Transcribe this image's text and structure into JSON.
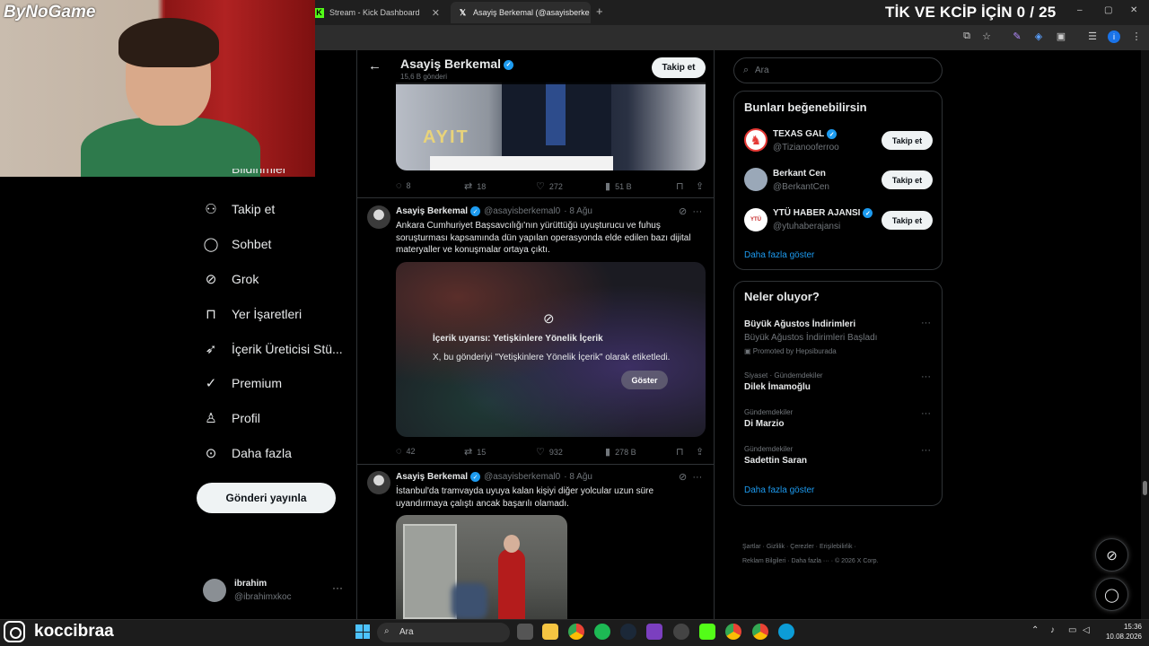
{
  "browser": {
    "tabs": [
      {
        "label": "Stream - Kick Dashboard",
        "icon": "kick-icon"
      },
      {
        "label": "Asayiş Berkemal (@asayisberke",
        "icon": "x-logo-icon"
      }
    ],
    "new_tab": "+",
    "window_controls": [
      "–",
      "▢",
      "✕"
    ]
  },
  "stream_overlay": {
    "logo": "ByNoGame",
    "counter": "TİK VE KCİP İÇİN 0 / 25",
    "instagram_name": "koccibraa"
  },
  "nav": {
    "items": [
      {
        "label": "Bildirimler",
        "icon": "bell-icon"
      },
      {
        "label": "Takip et",
        "icon": "follow-icon"
      },
      {
        "label": "Sohbet",
        "icon": "chat-icon"
      },
      {
        "label": "Grok",
        "icon": "grok-icon"
      },
      {
        "label": "Yer İşaretleri",
        "icon": "bookmark-icon"
      },
      {
        "label": "İçerik Üreticisi Stü...",
        "icon": "rocket-icon"
      },
      {
        "label": "Premium",
        "icon": "premium-icon"
      },
      {
        "label": "Profil",
        "icon": "profile-icon"
      },
      {
        "label": "Daha fazla",
        "icon": "more-icon"
      }
    ],
    "post_button": "Gönderi yayınla",
    "account": {
      "name": "ibrahim",
      "handle": "@ibrahimxkoc",
      "more": "···"
    }
  },
  "timeline": {
    "header": {
      "title": "Asayiş Berkemal",
      "subtitle": "15,6 B gönderi",
      "follow_label": "Takip et"
    },
    "tweets": [
      {
        "photo_text": "AYIT",
        "actions": {
          "replies": "8",
          "reposts": "18",
          "likes": "272",
          "views": "51 B"
        }
      },
      {
        "name": "Asayiş Berkemal",
        "handle": "@asayisberkemal0",
        "date": "· 8 Ağu",
        "text": "Ankara Cumhuriyet Başsavcılığı'nın yürüttüğü uyuşturucu ve fuhuş soruşturması kapsamında dün yapılan operasyonda elde edilen bazı dijital materyaller ve konuşmalar ortaya çıktı.",
        "warning": {
          "title": "İçerik uyarısı: Yetişkinlere Yönelik İçerik",
          "description": "X, bu gönderiyi \"Yetişkinlere Yönelik İçerik\" olarak etiketledi.",
          "button": "Göster"
        },
        "actions": {
          "replies": "42",
          "reposts": "15",
          "likes": "932",
          "views": "278 B"
        }
      },
      {
        "name": "Asayiş Berkemal",
        "handle": "@asayisberkemal0",
        "date": "· 8 Ağu",
        "text": "İstanbul'da tramvayda uyuya kalan kişiyi diğer yolcular uzun süre uyandırmaya çalıştı ancak başarılı olamadı."
      }
    ]
  },
  "sidebar": {
    "search_placeholder": "Ara",
    "suggestions": {
      "title": "Bunları beğenebilirsin",
      "items": [
        {
          "name": "TEXAS GAL",
          "handle": "@Tizianooferroo",
          "button": "Takip et",
          "avatar_color": "#ffffff"
        },
        {
          "name": "Berkant Cen",
          "handle": "@BerkantCen",
          "button": "Takip et",
          "avatar_color": "#9aa8b8"
        },
        {
          "name": "YTÜ HABER AJANSI",
          "handle": "@ytuhaberajansi",
          "button": "Takip et",
          "avatar_color": "#ffffff"
        }
      ],
      "more": "Daha fazla göster"
    },
    "trends": {
      "title": "Neler oluyor?",
      "items": [
        {
          "category": "",
          "name": "Büyük Ağustos İndirimleri",
          "subtitle": "Büyük Ağustos İndirimleri Başladı",
          "promo": "Promoted by Hepsiburada"
        },
        {
          "category": "Siyaset · Gündemdekiler",
          "name": "Dilek İmamoğlu"
        },
        {
          "category": "Gündemdekiler",
          "name": "Di Marzio"
        },
        {
          "category": "Gündemdekiler",
          "name": "Sadettin Saran"
        }
      ],
      "more": "Daha fazla göster"
    },
    "footer": {
      "line1": "Şartlar  ·  Gizlilik  ·  Çerezler  ·  Erişilebilirlik  ·",
      "line2": "Reklam Bilgileri  ·  Daha fazla ···  ·  © 2026 X Corp."
    }
  },
  "taskbar": {
    "search_placeholder": "Ara",
    "time": "15:36",
    "date": "10.08.2026"
  },
  "colors": {
    "accent": "#1d9bf0",
    "background": "#000000",
    "text": "#e7e9ea",
    "muted": "#71767b"
  }
}
